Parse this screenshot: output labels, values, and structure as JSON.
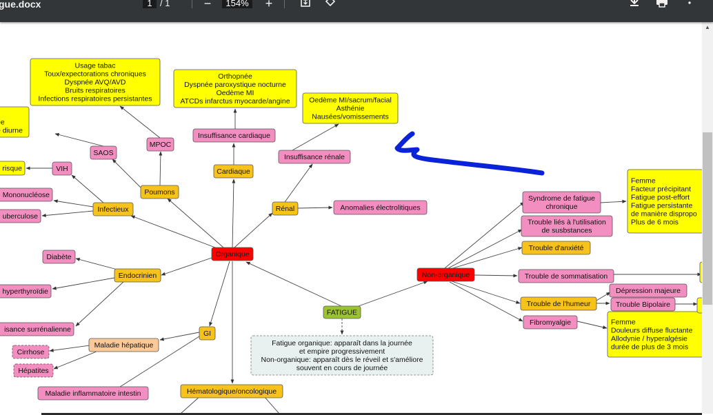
{
  "toolbar": {
    "title": "gue.docx",
    "page_current": "1",
    "page_total": "/ 1",
    "zoom": "154%",
    "zoom_out_label": "−",
    "zoom_in_label": "+",
    "fit_icon": "fit-page-icon",
    "rotate_icon": "rotate-icon",
    "download_icon": "download-icon",
    "print_icon": "print-icon",
    "more_icon": "more-vert-icon"
  },
  "colors": {
    "yellow": "#ffff00",
    "pink": "#f28ec0",
    "orange": "#f7c21a",
    "red": "#ff0000",
    "green": "#9bc331",
    "peach": "#f9c99a",
    "note": "#e9f0f0",
    "pen": "#0a22d8"
  },
  "nodes": {
    "fatigue": "FATIGUE",
    "organique": "Organique",
    "non_organique": "Non-organique",
    "cardiaque": "Cardiaque",
    "insuffisance_cardiaque": "Insuffisance cardiaque",
    "cardiaque_box": [
      "Orthopnée",
      "Dyspnée paroxystique nocturne",
      "Oedème MI",
      "ATCDs infarctus myocarde/angine"
    ],
    "renal": "Rénal",
    "insuffisance_renale": "Insuffisance rénale",
    "renal_box": [
      "Oedème MI/sacrum/facial",
      "Asthénie",
      "Nausées/vomissements"
    ],
    "anomalies": "Anomalies électrolitiques",
    "poumons": "Poumons",
    "mpoc": "MPOC",
    "saos": "SAOS",
    "poumons_box": [
      "Usage tabac",
      "Toux/expectorations chroniques",
      "Dyspnée AVQ/AVD",
      "Bruits respiratoires",
      "Infections respiratoires persistantes"
    ],
    "saos_box": [
      "s",
      "ée",
      "e diurne"
    ],
    "infectieux": "Infectieux",
    "vih": "VIH",
    "vih_box": "risque",
    "mononucleose": "Mononucléose",
    "tuberculose": "uberculose",
    "endocrinien": "Endocrinien",
    "diabete": "Diabète",
    "hyperthyroidie": "hyperthyroïdie",
    "surrenalienne": "isance surrénalienne",
    "gi": "GI",
    "maladie_hepatique": "Maladie hépatique",
    "cirrhose": "Cirrhose",
    "hepatites": "Hépatites",
    "maladie_inflammatoire": "Maladie inflammatoire intestin",
    "hemato": "Hématologique/oncologique",
    "note": [
      "Fatigue organique: apparaît dans la journée",
      "et empire progressivement",
      "Non-organique: apparaît dès le réveil et s'améliore",
      "souvent en cours de journée"
    ],
    "syndrome": [
      "Syndrome de fatigue",
      "chronique"
    ],
    "syndrome_box": [
      "Femme",
      "Facteur précipitant",
      "Fatigue post-effort",
      "Fatigue persistante",
      "de manière dispropo",
      "Plus de 6 mois"
    ],
    "trouble_substances": [
      "Trouble liés à l'utilisation",
      "de susbstances"
    ],
    "anxiete": "Trouble d'anxiété",
    "somatisation": "Trouble de sommatisation",
    "humeur": "Trouble de l'humeur",
    "depression": "Dépression majeure",
    "bipolaire": "Trouble Bipolaire",
    "fibromyalgie": "Fibromyalgie",
    "fibro_box": [
      "Femme",
      "Douleurs diffuse fluctante",
      "Allodynie / hyperalgésie",
      "durée de plus de 3 mois"
    ]
  }
}
